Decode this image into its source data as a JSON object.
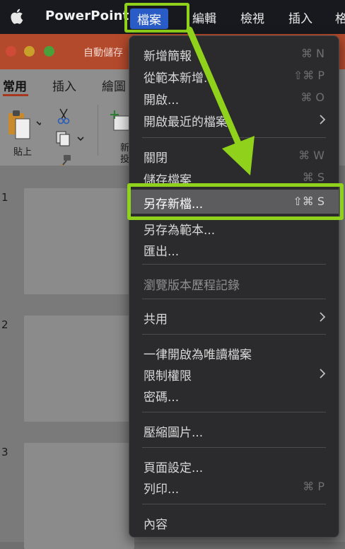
{
  "menubar": {
    "app_name": "PowerPoint",
    "items": [
      {
        "label": "檔案",
        "active": true
      },
      {
        "label": "編輯"
      },
      {
        "label": "檢視"
      },
      {
        "label": "插入"
      },
      {
        "label": "格"
      }
    ]
  },
  "window": {
    "autosave_label": "自動儲存",
    "ribbon_tabs": [
      "常用",
      "插入",
      "繪圖"
    ],
    "paste_label": "貼上",
    "new_slide_label": "新投",
    "slide_numbers": [
      "1",
      "2",
      "3"
    ]
  },
  "file_menu": {
    "items": [
      {
        "label": "新增簡報",
        "shortcut": "⌘ N"
      },
      {
        "label": "從範本新增...",
        "shortcut": "⇧⌘ P"
      },
      {
        "label": "開啟...",
        "shortcut": "⌘ O"
      },
      {
        "label": "開啟最近的檔案",
        "submenu": true
      },
      {
        "label": "關閉",
        "shortcut": "⌘ W"
      },
      {
        "label": "儲存檔案",
        "shortcut": "⌘ S"
      },
      {
        "label": "另存新檔...",
        "shortcut": "⇧⌘ S",
        "highlighted": true
      },
      {
        "label": "另存為範本..."
      },
      {
        "label": "匯出..."
      },
      {
        "label": "瀏覽版本歷程記錄",
        "disabled": true
      },
      {
        "label": "共用",
        "submenu": true
      },
      {
        "label": "一律開啟為唯讀檔案"
      },
      {
        "label": "限制權限",
        "submenu": true
      },
      {
        "label": "密碼..."
      },
      {
        "label": "壓縮圖片..."
      },
      {
        "label": "頁面設定..."
      },
      {
        "label": "列印...",
        "shortcut": "⌘ P"
      },
      {
        "label": "內容"
      }
    ]
  },
  "colors": {
    "annotation_green": "#8fd11b",
    "menubar_bg": "#17191f",
    "menu_bg": "#2b2b2d",
    "title_bar": "#b44a2c"
  },
  "icons": [
    "apple-icon",
    "chevron-right-icon",
    "scissors-icon",
    "copy-icon",
    "format-painter-icon",
    "clipboard-icon",
    "new-slide-icon"
  ]
}
